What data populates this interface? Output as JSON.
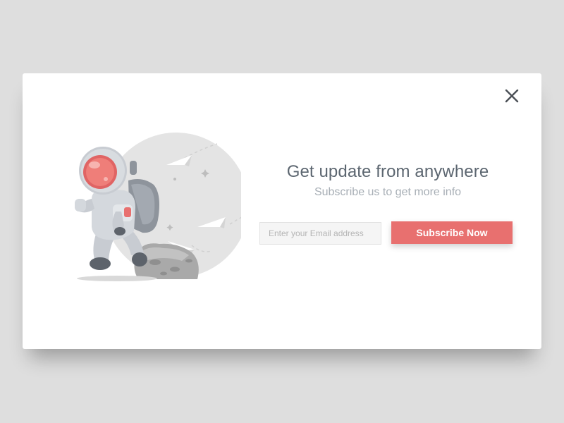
{
  "popup": {
    "headline": "Get update from anywhere",
    "subheadline": "Subscribe us to get more info",
    "email_placeholder": "Enter your Email address",
    "email_value": "",
    "subscribe_label": "Subscribe Now",
    "close_icon": "close-icon",
    "illustration": "astronaut-illustration"
  },
  "colors": {
    "page_background": "#dedede",
    "modal_background": "#ffffff",
    "headline": "#5c6670",
    "subheadline": "#a7aeb5",
    "button": "#e8706f",
    "button_text": "#ffffff",
    "input_background": "#f5f5f5",
    "illustration_circle": "#e4e4e4"
  }
}
